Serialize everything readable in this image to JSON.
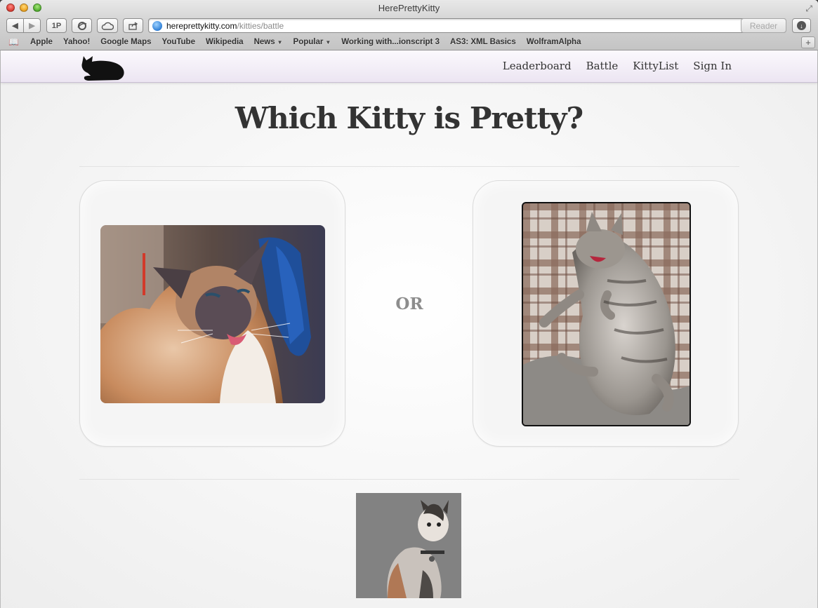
{
  "browser": {
    "window_title": "HerePrettyKitty",
    "url_host": "hereprettykitty.com",
    "url_path": "/kitties/battle",
    "reader_label": "Reader",
    "onepassword_label": "1P",
    "bookmarks": [
      {
        "label": "Apple",
        "has_menu": false
      },
      {
        "label": "Yahoo!",
        "has_menu": false
      },
      {
        "label": "Google Maps",
        "has_menu": false
      },
      {
        "label": "YouTube",
        "has_menu": false
      },
      {
        "label": "Wikipedia",
        "has_menu": false
      },
      {
        "label": "News",
        "has_menu": true
      },
      {
        "label": "Popular",
        "has_menu": true
      },
      {
        "label": "Working with...ionscript 3",
        "has_menu": false
      },
      {
        "label": "AS3: XML Basics",
        "has_menu": false
      },
      {
        "label": "WolframAlpha",
        "has_menu": false
      }
    ]
  },
  "site": {
    "nav": {
      "leaderboard": "Leaderboard",
      "battle": "Battle",
      "kittylist": "KittyList",
      "signin": "Sign In"
    },
    "heading": "Which Kitty is Pretty?",
    "or_label": "OR"
  },
  "colors": {
    "navbar_bg": "#ece5f2",
    "heading": "#333333",
    "or_text": "#8d8d8d"
  }
}
